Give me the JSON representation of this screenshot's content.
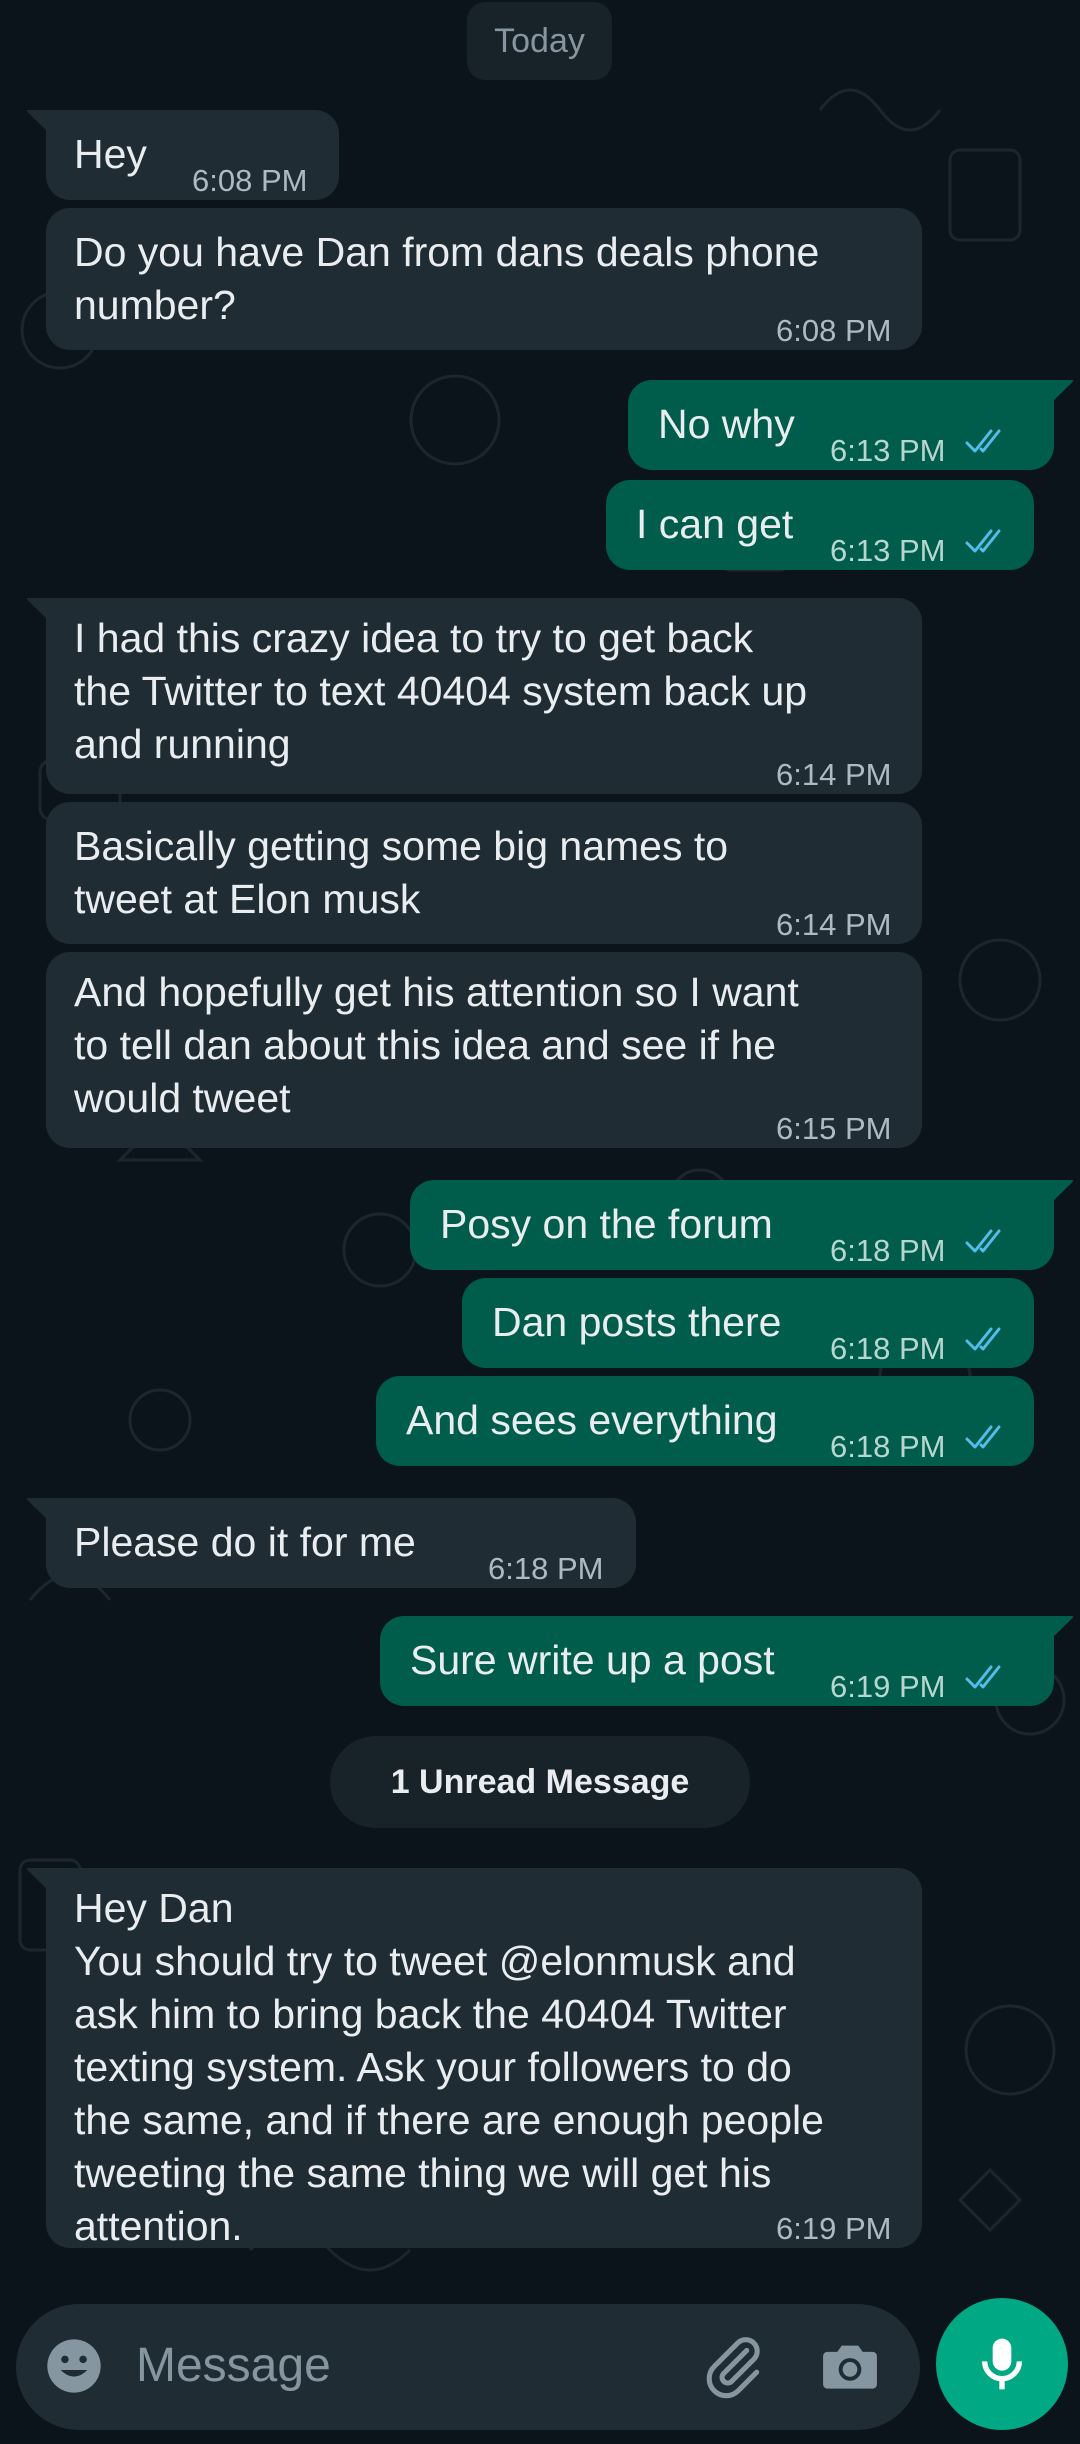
{
  "chat": {
    "date_label": "Today",
    "unread_label": "1 Unread Message",
    "messages": [
      {
        "dir": "in",
        "text": "Hey",
        "time": "6:08 PM"
      },
      {
        "dir": "in",
        "text": "Do you have Dan from dans deals phone\nnumber?",
        "time": "6:08 PM"
      },
      {
        "dir": "out",
        "text": "No why",
        "time": "6:13 PM",
        "status": "read"
      },
      {
        "dir": "out",
        "text": "I can get",
        "time": "6:13 PM",
        "status": "read"
      },
      {
        "dir": "in",
        "text": "I had this crazy idea to try to get back\nthe Twitter to text 40404 system back up\nand running",
        "time": "6:14 PM"
      },
      {
        "dir": "in",
        "text": "Basically getting some big names to\ntweet at Elon musk",
        "time": "6:14 PM"
      },
      {
        "dir": "in",
        "text": "And hopefully get his attention so I want\nto tell dan about this idea and see if he\nwould tweet",
        "time": "6:15 PM"
      },
      {
        "dir": "out",
        "text": "Posy on the forum",
        "time": "6:18 PM",
        "status": "read"
      },
      {
        "dir": "out",
        "text": "Dan posts there",
        "time": "6:18 PM",
        "status": "read"
      },
      {
        "dir": "out",
        "text": "And sees everything",
        "time": "6:18 PM",
        "status": "read"
      },
      {
        "dir": "in",
        "text": "Please do it for me",
        "time": "6:18 PM"
      },
      {
        "dir": "out",
        "text": "Sure write up a post",
        "time": "6:19 PM",
        "status": "read"
      },
      {
        "dir": "in",
        "text": "Hey Dan\nYou should try to tweet @elonmusk and\nask him to bring back the 40404 Twitter\ntexting system. Ask your followers to do\nthe same, and if there are enough people\ntweeting the same thing we will get his\nattention.",
        "time": "6:19 PM"
      }
    ]
  },
  "composer": {
    "placeholder": "Message",
    "icons": [
      "emoji-icon",
      "attach-icon",
      "camera-icon",
      "mic-icon"
    ]
  },
  "colors": {
    "background": "#0b141a",
    "incoming_bubble": "#202c33",
    "outgoing_bubble": "#005c4b",
    "read_ticks": "#53bdeb",
    "accent": "#00a884"
  }
}
